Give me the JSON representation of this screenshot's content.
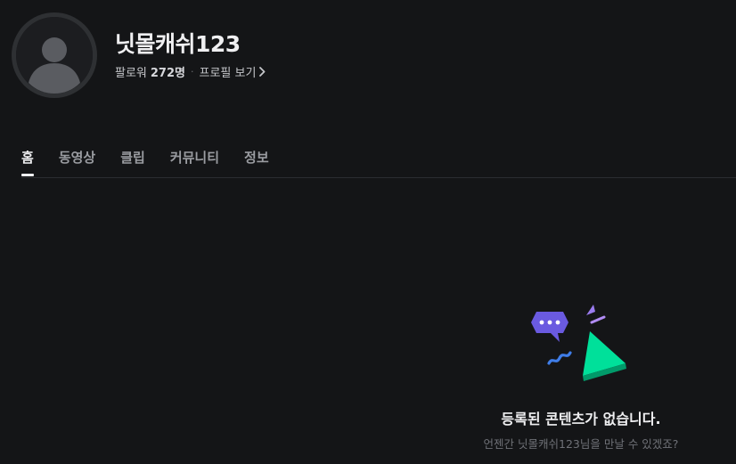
{
  "channel": {
    "name": "닛몰캐쉬123",
    "followers_label": "팔로워",
    "followers_count": "272명",
    "separator": "·",
    "profile_link": "프로필 보기"
  },
  "tabs": [
    {
      "label": "홈",
      "active": true
    },
    {
      "label": "동영상",
      "active": false
    },
    {
      "label": "클립",
      "active": false
    },
    {
      "label": "커뮤니티",
      "active": false
    },
    {
      "label": "정보",
      "active": false
    }
  ],
  "empty_state": {
    "title": "등록된 콘텐츠가 없습니다.",
    "subtitle": "언젠간 닛몰캐쉬123님을 만날 수 있겠죠?"
  },
  "icons": {
    "avatar": "default-user-avatar-icon",
    "chevron": "chevron-right-icon",
    "illustration": "empty-content-illustration"
  },
  "colors": {
    "background": "#141517",
    "accent_green": "#00d68f",
    "accent_purple": "#6c5ce7"
  }
}
